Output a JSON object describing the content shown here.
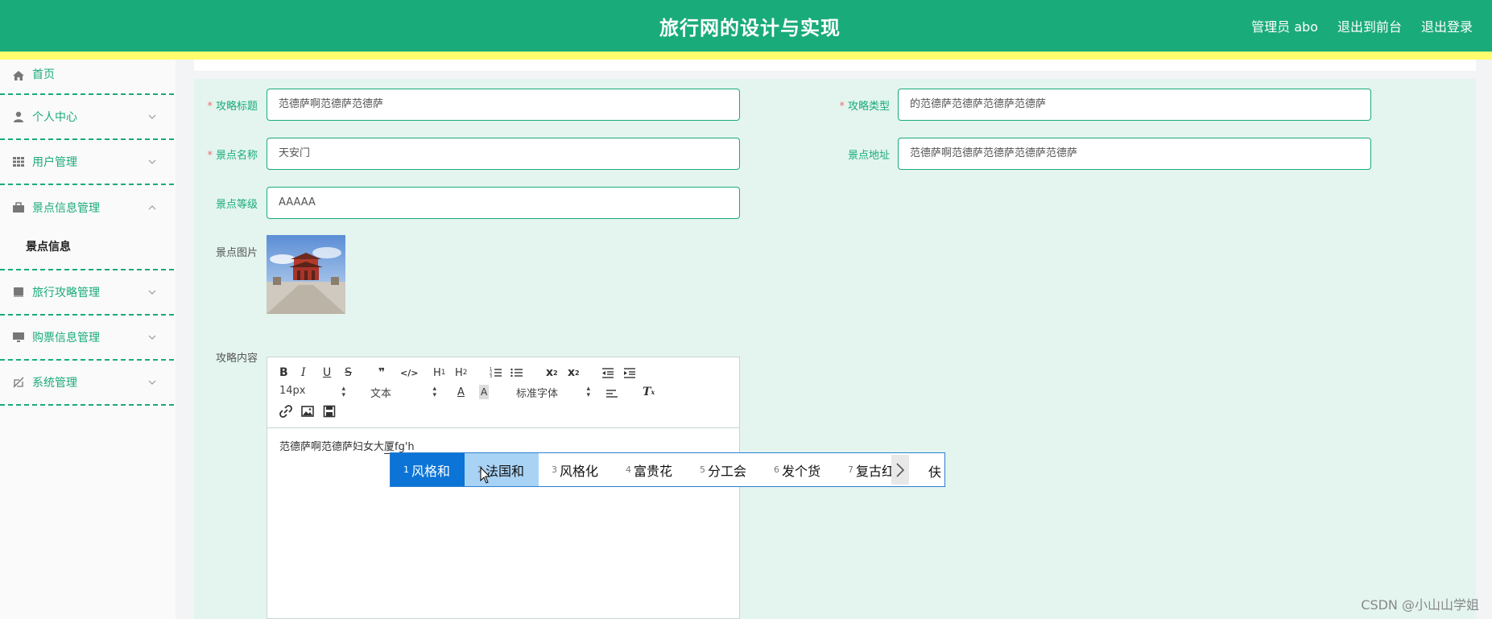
{
  "header": {
    "title": "旅行网的设计与实现",
    "links": [
      "管理员 abo",
      "退出到前台",
      "退出登录"
    ]
  },
  "sidebar": {
    "items": [
      {
        "label": "首页",
        "icon": "home-icon"
      },
      {
        "label": "个人中心",
        "icon": "user-icon"
      },
      {
        "label": "用户管理",
        "icon": "grid-icon"
      },
      {
        "label": "景点信息管理",
        "icon": "briefcase-icon",
        "sub": [
          "景点信息"
        ]
      },
      {
        "label": "旅行攻略管理",
        "icon": "book-icon"
      },
      {
        "label": "购票信息管理",
        "icon": "monitor-icon"
      },
      {
        "label": "系统管理",
        "icon": "settings-off-icon"
      }
    ]
  },
  "form": {
    "title_label": "攻略标题",
    "title_value": "范德萨啊范德萨范德萨",
    "type_label": "攻略类型",
    "type_value": "的范德萨范德萨范德萨范德萨",
    "spot_name_label": "景点名称",
    "spot_name_value": "天安门",
    "spot_addr_label": "景点地址",
    "spot_addr_value": "范德萨啊范德萨范德萨范德萨范德萨",
    "spot_level_label": "景点等级",
    "spot_level_value": "AAAAA",
    "spot_image_label": "景点图片",
    "content_label": "攻略内容"
  },
  "editor": {
    "font_size": "14px",
    "block_type": "文本",
    "font_family": "标准字体",
    "text_before": "范德萨啊范德萨妇女大",
    "text_composing": "厦fg'h"
  },
  "ime": {
    "candidates": [
      {
        "n": "1",
        "t": "风格和"
      },
      {
        "n": "2",
        "t": "法国和"
      },
      {
        "n": "3",
        "t": "风格化"
      },
      {
        "n": "4",
        "t": "富贵花"
      },
      {
        "n": "5",
        "t": "分工会"
      },
      {
        "n": "6",
        "t": "发个货"
      },
      {
        "n": "7",
        "t": "复古红"
      }
    ],
    "overflow": "伕"
  },
  "watermark": "CSDN @小山山学姐",
  "colors": {
    "brand": "#1aab7a",
    "accent_bar": "#fffd6e",
    "content_bg": "#e3f5ee",
    "required": "#f56c6c"
  }
}
